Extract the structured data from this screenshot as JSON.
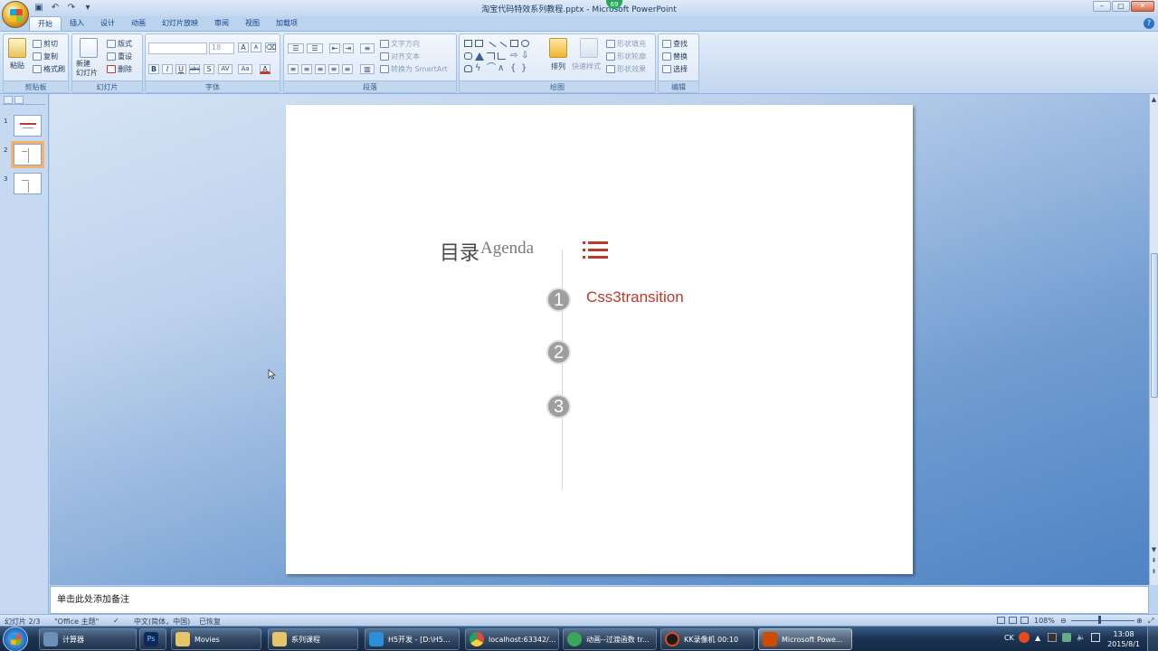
{
  "window": {
    "title": "淘宝代码特效系列教程.pptx - Microsoft PowerPoint",
    "notification_badge": "69"
  },
  "ribbon_tabs": [
    "开始",
    "插入",
    "设计",
    "动画",
    "幻灯片放映",
    "审阅",
    "视图",
    "加载项"
  ],
  "ribbon": {
    "clipboard": {
      "paste": "粘贴",
      "cut": "剪切",
      "copy": "复制",
      "format_painter": "格式刷",
      "label": "剪贴板"
    },
    "slides": {
      "new_slide": "新建\n幻灯片",
      "layout": "版式",
      "reset": "重设",
      "delete": "删除",
      "label": "幻灯片"
    },
    "font": {
      "size": "18",
      "bold": "B",
      "italic": "I",
      "underline": "U",
      "strike": "abc",
      "shadow": "S",
      "spacing": "AV",
      "case": "Aa",
      "grow": "A",
      "shrink": "A",
      "color": "A",
      "label": "字体"
    },
    "paragraph": {
      "text_direction": "文字方向",
      "align_text": "对齐文本",
      "smartart": "转换为 SmartArt",
      "label": "段落"
    },
    "drawing": {
      "arrange": "排列",
      "quick_styles": "快速样式",
      "shape_fill": "形状填充",
      "shape_outline": "形状轮廓",
      "shape_effects": "形状效果",
      "label": "绘图"
    },
    "editing": {
      "find": "查找",
      "replace": "替换",
      "select": "选择",
      "label": "编辑"
    }
  },
  "slide_panel": {
    "numbers": [
      "1",
      "2",
      "3"
    ],
    "selected": 2
  },
  "slide": {
    "title_cn": "目录",
    "title_en": "Agenda",
    "items": [
      {
        "num": "1",
        "text": "Css3transition"
      },
      {
        "num": "2",
        "text": ""
      },
      {
        "num": "3",
        "text": ""
      }
    ],
    "accent_color": "#c0392b"
  },
  "notes": {
    "placeholder": "单击此处添加备注"
  },
  "status": {
    "slide_pos": "幻灯片 2/3",
    "theme": "\"Office 主题\"",
    "language": "中文(简体，中国)",
    "recovered": "已恢复",
    "zoom": "108%"
  },
  "taskbar": {
    "apps": [
      {
        "label": "计算器",
        "icon_color": "#6b8fb8"
      },
      {
        "label": "",
        "icon_color": "#0b2a5c",
        "icon_text": "Ps"
      },
      {
        "label": "Movies",
        "icon_color": "#e6c46a"
      },
      {
        "label": "系列课程",
        "icon_color": "#e6c46a"
      },
      {
        "label": "H5开发 - [D:\\H5...",
        "icon_color": "#2a8fd8"
      },
      {
        "label": "localhost:63342/...",
        "icon_color": "#dd4b39"
      },
      {
        "label": "动画--过渡函数 tr...",
        "icon_color": "#3aa757"
      },
      {
        "label": "KK录像机 00:10",
        "icon_color": "#1b1b1b"
      },
      {
        "label": "Microsoft Powe...",
        "icon_color": "#d04a02"
      }
    ],
    "tray": {
      "ime": "CK",
      "time": "13:08",
      "date": "2015/8/1"
    }
  }
}
